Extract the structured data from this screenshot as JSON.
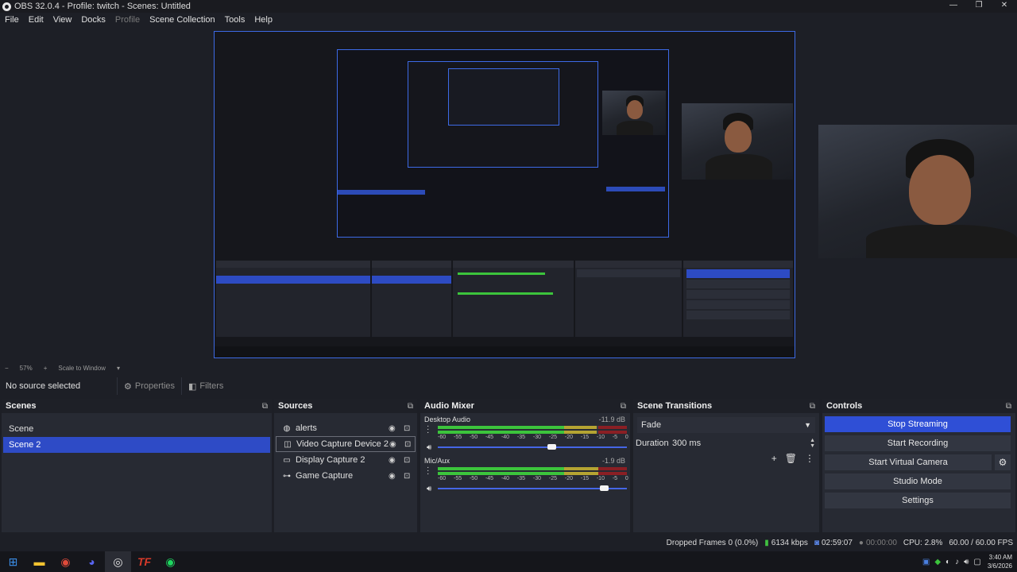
{
  "window": {
    "title": "OBS 32.0.4 - Profile: twitch - Scenes: Untitled",
    "minimize": "—",
    "maximize": "❐",
    "close": "✕"
  },
  "menu": {
    "file": "File",
    "edit": "Edit",
    "view": "View",
    "docks": "Docks",
    "profile": "Profile",
    "scene_collection": "Scene Collection",
    "tools": "Tools",
    "help": "Help"
  },
  "preview": {
    "zoom": "57%",
    "scale_mode": "Scale to Window"
  },
  "context": {
    "no_source": "No source selected",
    "properties": "Properties",
    "filters": "Filters"
  },
  "scenes": {
    "title": "Scenes",
    "items": [
      "Scene",
      "Scene 2"
    ],
    "selected_index": 1
  },
  "sources": {
    "title": "Sources",
    "items": [
      {
        "label": "alerts",
        "icon": "globe-icon"
      },
      {
        "label": "Video Capture Device 2",
        "icon": "camera-icon"
      },
      {
        "label": "Display Capture 2",
        "icon": "monitor-icon"
      },
      {
        "label": "Game Capture",
        "icon": "gamepad-icon"
      }
    ]
  },
  "mixer": {
    "title": "Audio Mixer",
    "ticks": [
      "-60",
      "-55",
      "-50",
      "-45",
      "-40",
      "-35",
      "-30",
      "-25",
      "-20",
      "-15",
      "-10",
      "-5",
      "0"
    ],
    "channels": [
      {
        "name": "Desktop Audio",
        "db": "-11.9 dB",
        "level": 0.84,
        "volume": 0.6
      },
      {
        "name": "Mic/Aux",
        "db": "-1.9 dB",
        "level": 0.89,
        "volume": 0.88
      }
    ]
  },
  "transitions": {
    "title": "Scene Transitions",
    "selected": "Fade",
    "duration_label": "Duration",
    "duration_value": "300 ms"
  },
  "controls": {
    "title": "Controls",
    "stop_streaming": "Stop Streaming",
    "start_recording": "Start Recording",
    "start_virtual_camera": "Start Virtual Camera",
    "studio_mode": "Studio Mode",
    "settings": "Settings"
  },
  "status": {
    "dropped_frames": "Dropped Frames 0 (0.0%)",
    "bitrate": "6134 kbps",
    "stream_time": "02:59:07",
    "record_time": "00:00:00",
    "cpu": "CPU: 2.8%",
    "fps": "60.00 / 60.00 FPS"
  },
  "taskbar": {
    "time": "3:40 AM",
    "date": "3/6/2026"
  },
  "colors": {
    "accent": "#2e4bc6",
    "meter_green": "#3cc43c",
    "meter_yellow": "#b5a432",
    "meter_red": "#8a1f24"
  }
}
